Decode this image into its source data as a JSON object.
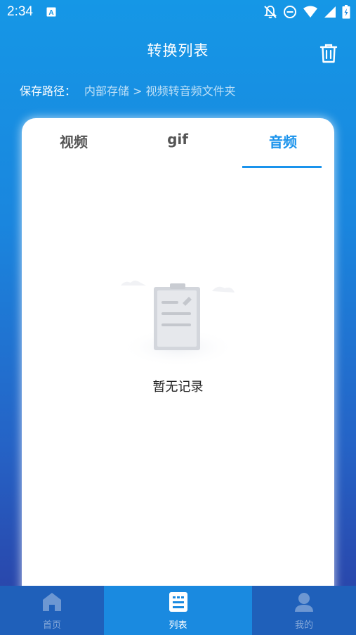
{
  "status_bar": {
    "time": "2:34",
    "icons": [
      "notification-a-icon",
      "bell-off-icon",
      "do-not-disturb-icon",
      "wifi-icon",
      "signal-icon",
      "battery-icon"
    ]
  },
  "header": {
    "title": "转换列表",
    "delete_icon": "trash-icon"
  },
  "save_path": {
    "label": "保存路径：",
    "value": "内部存储 > 视频转音频文件夹"
  },
  "tabs": [
    {
      "label": "视频",
      "active": false
    },
    {
      "label": "gif",
      "active": false
    },
    {
      "label": "音频",
      "active": true
    }
  ],
  "empty_state": {
    "icon": "clipboard-icon",
    "text": "暂无记录"
  },
  "bottom_nav": [
    {
      "label": "首页",
      "icon": "home-icon",
      "active": false
    },
    {
      "label": "列表",
      "icon": "list-icon",
      "active": true
    },
    {
      "label": "我的",
      "icon": "user-icon",
      "active": false
    }
  ],
  "colors": {
    "accent": "#1a93ec",
    "nav_bg": "#1f60ba",
    "nav_active_bg": "#1a8ae0"
  }
}
